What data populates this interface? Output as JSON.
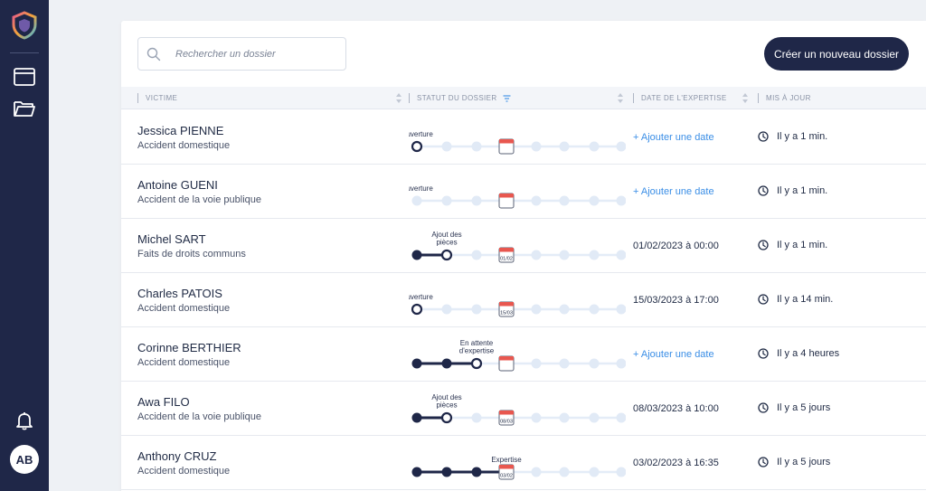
{
  "sidebar": {
    "logo": "shield-logo-icon",
    "items": [
      {
        "name": "dashboard-window-icon"
      },
      {
        "name": "folder-icon"
      }
    ],
    "bell": "bell-icon",
    "avatar": "AB"
  },
  "search": {
    "placeholder": "Rechercher un dossier"
  },
  "new_button_label": "Créer un nouveau dossier",
  "table": {
    "headers": {
      "victim": "VICTIME",
      "status": "STATUT DU DOSSIER",
      "date": "DATE DE L'EXPERTISE",
      "updated": "MIS À JOUR"
    },
    "rows": [
      {
        "name": "Jessica PIENNE",
        "type": "Accident domestique",
        "step": 0,
        "step_label": [
          "Ouverture"
        ],
        "cal_date": "",
        "date": "+ Ajouter une date",
        "date_is_action": true,
        "updated": "Il y a 1 min."
      },
      {
        "name": "Antoine GUENI",
        "type": "Accident de la voie publique",
        "step": -1,
        "step_label": [
          "Ouverture"
        ],
        "cal_date": "",
        "date": "+ Ajouter une date",
        "date_is_action": true,
        "updated": "Il y a 1 min."
      },
      {
        "name": "Michel SART",
        "type": "Faits de droits communs",
        "step": 1,
        "step_label": [
          "Ajout des",
          "pièces"
        ],
        "cal_date": "01/02",
        "date": "01/02/2023 à 00:00",
        "date_is_action": false,
        "updated": "Il y a 1 min."
      },
      {
        "name": "Charles PATOIS",
        "type": "Accident domestique",
        "step": 0,
        "step_label": [
          "Ouverture"
        ],
        "cal_date": "15/03",
        "date": "15/03/2023 à 17:00",
        "date_is_action": false,
        "updated": "Il y a 14 min."
      },
      {
        "name": "Corinne BERTHIER",
        "type": "Accident domestique",
        "step": 2,
        "step_label": [
          "En attente",
          "d'expertise"
        ],
        "cal_date": "",
        "date": "+ Ajouter une date",
        "date_is_action": true,
        "updated": "Il y a 4 heures"
      },
      {
        "name": "Awa FILO",
        "type": "Accident de la voie publique",
        "step": 1,
        "step_label": [
          "Ajout des",
          "pièces"
        ],
        "cal_date": "08/03",
        "date": "08/03/2023 à 10:00",
        "date_is_action": false,
        "updated": "Il y a 5 jours"
      },
      {
        "name": "Anthony CRUZ",
        "type": "Accident domestique",
        "step": 3,
        "step_label": [
          "Expertise"
        ],
        "cal_date": "03/02",
        "date": "03/02/2023 à 16:35",
        "date_is_action": false,
        "updated": "Il y a 5 jours"
      }
    ]
  },
  "colors": {
    "navy": "#1f2748",
    "accent_blue": "#3a8ee6",
    "calendar_red": "#e8574f",
    "inactive_dot": "#e1eaf6"
  }
}
